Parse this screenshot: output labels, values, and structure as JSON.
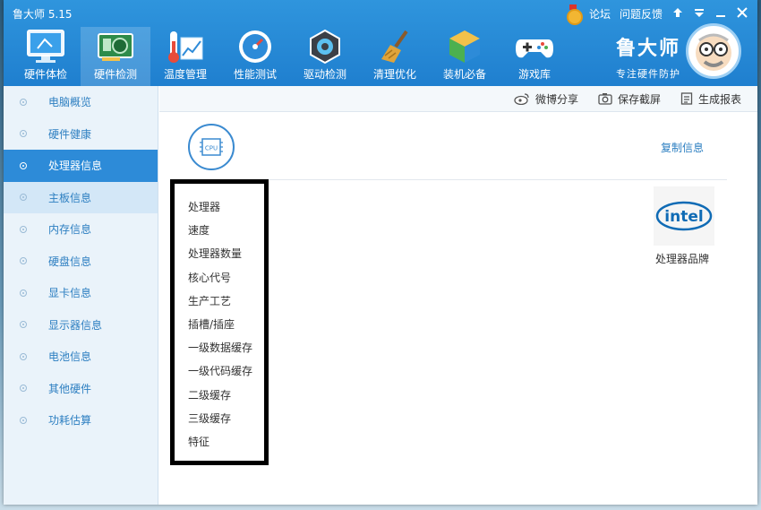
{
  "window": {
    "title": "鲁大师 5.15"
  },
  "top_links": {
    "forum": "论坛",
    "feedback": "问题反馈"
  },
  "nav": [
    {
      "label": "硬件体检",
      "icon": "monitor-icon"
    },
    {
      "label": "硬件检测",
      "icon": "graphics-card-icon"
    },
    {
      "label": "温度管理",
      "icon": "thermometer-icon"
    },
    {
      "label": "性能测试",
      "icon": "speedometer-icon"
    },
    {
      "label": "驱动检测",
      "icon": "driver-gear-icon"
    },
    {
      "label": "清理优化",
      "icon": "broom-icon"
    },
    {
      "label": "装机必备",
      "icon": "package-box-icon"
    },
    {
      "label": "游戏库",
      "icon": "gamepad-icon"
    }
  ],
  "brand": {
    "name": "鲁大师",
    "slogan": "专注硬件防护"
  },
  "sidebar": [
    {
      "label": "电脑概览"
    },
    {
      "label": "硬件健康"
    },
    {
      "label": "处理器信息"
    },
    {
      "label": "主板信息"
    },
    {
      "label": "内存信息"
    },
    {
      "label": "硬盘信息"
    },
    {
      "label": "显卡信息"
    },
    {
      "label": "显示器信息"
    },
    {
      "label": "电池信息"
    },
    {
      "label": "其他硬件"
    },
    {
      "label": "功耗估算"
    }
  ],
  "toolbar": {
    "weibo_share": "微博分享",
    "save_screenshot": "保存截屏",
    "generate_report": "生成报表"
  },
  "content": {
    "cpu_badge": "CPU",
    "copy_info": "复制信息",
    "labels": [
      "处理器",
      "速度",
      "处理器数量",
      "核心代号",
      "生产工艺",
      "插槽/插座",
      "一级数据缓存",
      "一级代码缓存",
      "二级缓存",
      "三级缓存",
      "特征"
    ],
    "brand_logo_text": "intel",
    "brand_caption": "处理器品牌"
  },
  "colors": {
    "header_blue": "#2f95dd",
    "sidebar_active": "#2d8bd8",
    "link_blue": "#2d7fc1"
  }
}
